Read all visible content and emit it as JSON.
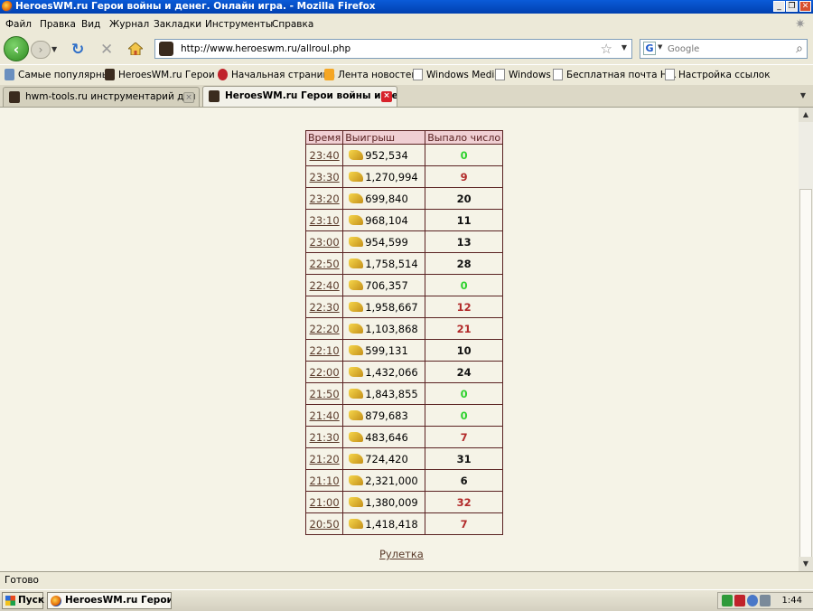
{
  "window": {
    "title": "HeroesWM.ru Герои войны и денег. Онлайн игра. - Mozilla Firefox",
    "minimize": "_",
    "restore": "❐",
    "close": "✕"
  },
  "menu": [
    "Файл",
    "Правка",
    "Вид",
    "Журнал",
    "Закладки",
    "Инструменты",
    "Справка"
  ],
  "nav": {
    "url": "http://www.heroeswm.ru/allroul.php",
    "search_placeholder": "Google",
    "search_engine_icon": "google-icon"
  },
  "bookmarks": [
    {
      "label": "Самые популярные",
      "icon": "most-visited-icon"
    },
    {
      "label": "HeroesWM.ru Герои ...",
      "icon": "heroeswm-icon"
    },
    {
      "label": "Начальная страница",
      "icon": "red-flame-icon"
    },
    {
      "label": "Лента новостей",
      "icon": "rss-icon"
    },
    {
      "label": "Windows Media",
      "icon": "page-icon"
    },
    {
      "label": "Windows",
      "icon": "page-icon"
    },
    {
      "label": "Бесплатная почта Н...",
      "icon": "page-icon"
    },
    {
      "label": "Настройка ссылок",
      "icon": "page-icon"
    }
  ],
  "tabs": [
    {
      "label": "hwm-tools.ru инструментарий для иг...",
      "active": false
    },
    {
      "label": "HeroesWM.ru Герои войны и ден...",
      "active": true
    }
  ],
  "table": {
    "headers": [
      "Время",
      "Выигрыш",
      "Выпало число"
    ],
    "rows": [
      {
        "time": "23:40",
        "win": "952,534",
        "number": "0",
        "color": "green"
      },
      {
        "time": "23:30",
        "win": "1,270,994",
        "number": "9",
        "color": "red"
      },
      {
        "time": "23:20",
        "win": "699,840",
        "number": "20",
        "color": "black"
      },
      {
        "time": "23:10",
        "win": "968,104",
        "number": "11",
        "color": "black"
      },
      {
        "time": "23:00",
        "win": "954,599",
        "number": "13",
        "color": "black"
      },
      {
        "time": "22:50",
        "win": "1,758,514",
        "number": "28",
        "color": "black"
      },
      {
        "time": "22:40",
        "win": "706,357",
        "number": "0",
        "color": "green"
      },
      {
        "time": "22:30",
        "win": "1,958,667",
        "number": "12",
        "color": "red"
      },
      {
        "time": "22:20",
        "win": "1,103,868",
        "number": "21",
        "color": "red"
      },
      {
        "time": "22:10",
        "win": "599,131",
        "number": "10",
        "color": "black"
      },
      {
        "time": "22:00",
        "win": "1,432,066",
        "number": "24",
        "color": "black"
      },
      {
        "time": "21:50",
        "win": "1,843,855",
        "number": "0",
        "color": "green"
      },
      {
        "time": "21:40",
        "win": "879,683",
        "number": "0",
        "color": "green"
      },
      {
        "time": "21:30",
        "win": "483,646",
        "number": "7",
        "color": "red"
      },
      {
        "time": "21:20",
        "win": "724,420",
        "number": "31",
        "color": "black"
      },
      {
        "time": "21:10",
        "win": "2,321,000",
        "number": "6",
        "color": "black"
      },
      {
        "time": "21:00",
        "win": "1,380,009",
        "number": "32",
        "color": "red"
      },
      {
        "time": "20:50",
        "win": "1,418,418",
        "number": "7",
        "color": "red"
      }
    ]
  },
  "roulette_link": "Рулетка",
  "status": "Готово",
  "taskbar": {
    "start": "Пуск",
    "task": "HeroesWM.ru Герои в...",
    "clock": "1:44"
  },
  "colors": {
    "green_number": "#2ed12e",
    "red_number": "#b22a2a",
    "header_bg": "#f0cfd3",
    "page_bg": "#f5f3e7"
  }
}
